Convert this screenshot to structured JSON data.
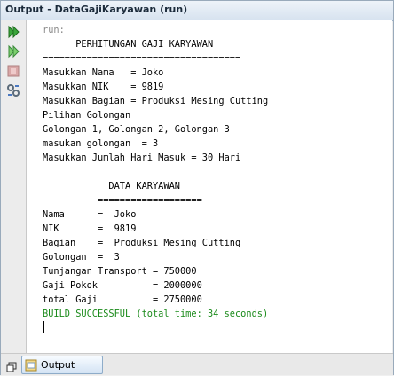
{
  "window": {
    "title": "Output - DataGajiKaryawan (run)"
  },
  "toolbar": {
    "buttons": [
      "rerun-icon",
      "rerun-with-options-icon",
      "stop-icon",
      "settings-icon"
    ]
  },
  "console": {
    "lines": [
      {
        "text": "run:",
        "style": "gray"
      },
      {
        "text": "      PERHITUNGAN GAJI KARYAWAN",
        "style": "normal"
      },
      {
        "text": "====================================",
        "style": "normal"
      },
      {
        "text": "Masukkan Nama   = Joko",
        "style": "normal"
      },
      {
        "text": "Masukkan NIK    = 9819",
        "style": "normal"
      },
      {
        "text": "Masukkan Bagian = Produksi Mesing Cutting",
        "style": "normal"
      },
      {
        "text": "Pilihan Golongan",
        "style": "normal"
      },
      {
        "text": "Golongan 1, Golongan 2, Golongan 3",
        "style": "normal"
      },
      {
        "text": "masukan golongan  = 3",
        "style": "normal"
      },
      {
        "text": "Masukkan Jumlah Hari Masuk = 30 Hari",
        "style": "normal"
      },
      {
        "text": "",
        "style": "normal"
      },
      {
        "text": "            DATA KARYAWAN",
        "style": "normal"
      },
      {
        "text": "          ===================",
        "style": "normal"
      },
      {
        "text": "Nama      =  Joko",
        "style": "normal"
      },
      {
        "text": "NIK       =  9819",
        "style": "normal"
      },
      {
        "text": "Bagian    =  Produksi Mesing Cutting",
        "style": "normal"
      },
      {
        "text": "Golongan  =  3",
        "style": "normal"
      },
      {
        "text": "Tunjangan Transport = 750000",
        "style": "normal"
      },
      {
        "text": "Gaji Pokok          = 2000000",
        "style": "normal"
      },
      {
        "text": "total Gaji          = 2750000",
        "style": "normal"
      },
      {
        "text": "BUILD SUCCESSFUL (total time: 34 seconds)",
        "style": "green"
      }
    ]
  },
  "bottom": {
    "tab_label": "Output"
  },
  "colors": {
    "success": "#1a8a1a",
    "run_label": "#8a8a8a",
    "tab_border": "#8eacc9"
  }
}
